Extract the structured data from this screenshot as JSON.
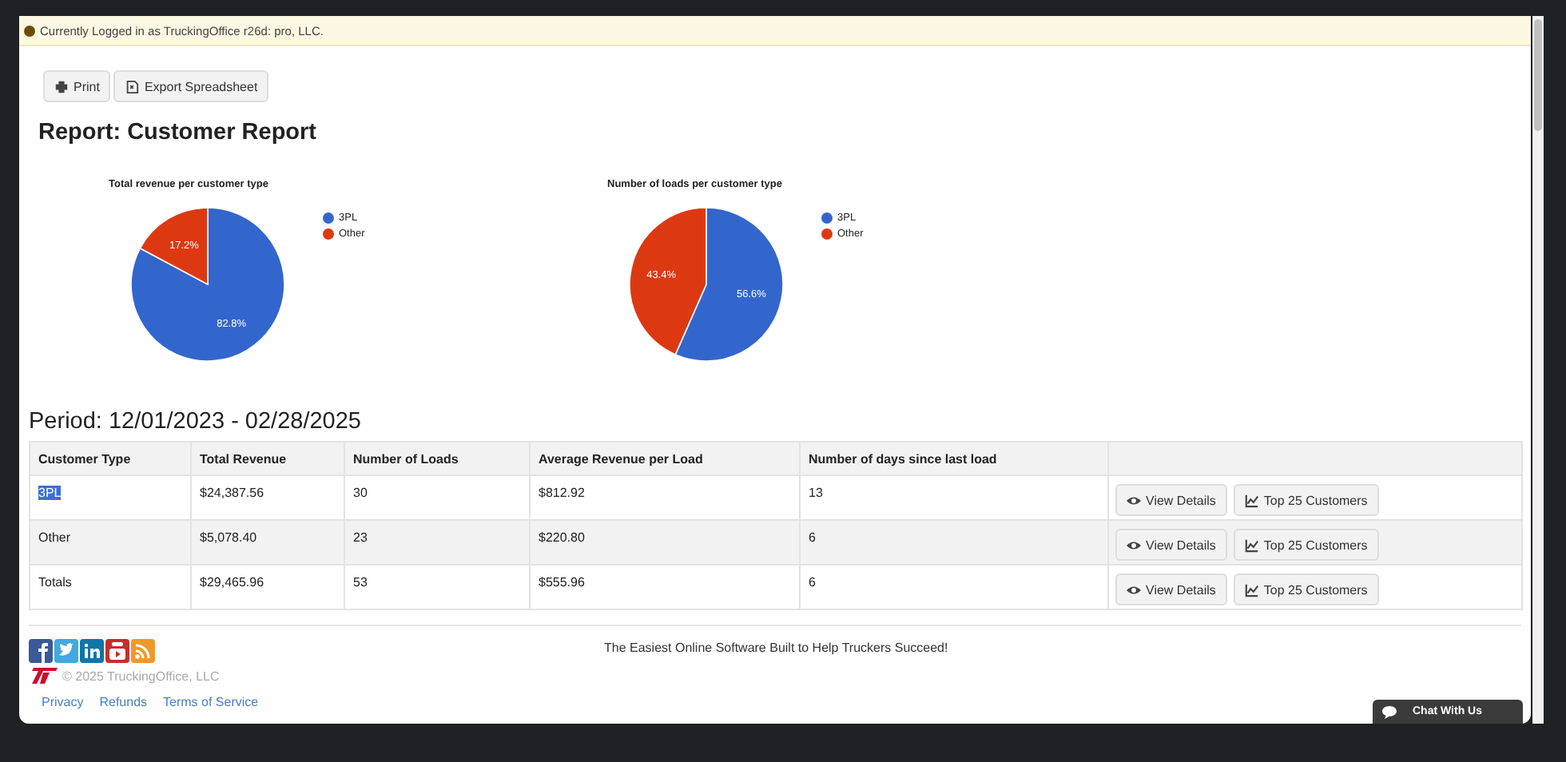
{
  "notice": {
    "text": "Currently Logged in as TruckingOffice r26d: pro, LLC."
  },
  "toolbar": [
    {
      "label": "Print",
      "kind": "print"
    },
    {
      "label": "Export Spreadsheet",
      "kind": "export"
    }
  ],
  "title": "Report: Customer Report",
  "charts": [
    {
      "chart_data": {
        "type": "pie",
        "title": "Total revenue per customer type",
        "categories": [
          "3PL",
          "Other"
        ],
        "values": [
          82.8,
          17.2
        ],
        "colors": [
          "#3366cc",
          "#dc3912"
        ],
        "legend": true,
        "value_labels": [
          "82.8%",
          "17.2%"
        ]
      }
    },
    {
      "chart_data": {
        "type": "pie",
        "title": "Number of loads per customer type",
        "categories": [
          "3PL",
          "Other"
        ],
        "values": [
          56.6,
          43.4
        ],
        "colors": [
          "#3366cc",
          "#dc3912"
        ],
        "legend": true,
        "value_labels": [
          "56.6%",
          "43.4%"
        ]
      }
    }
  ],
  "period": "Period: 12/01/2023 - 02/28/2025",
  "table": {
    "columns": [
      "Customer Type",
      "Total Revenue",
      "Number of Loads",
      "Average Revenue per Load",
      "Number of days since last load"
    ],
    "rows": [
      {
        "cells": [
          "3PL",
          "$24,387.56",
          "30",
          "$812.92",
          "13"
        ],
        "highlighted": true,
        "actions": [
          {
            "label": "View Details",
            "kind": "view"
          },
          {
            "label": "Top 25 Customers",
            "kind": "chart"
          }
        ]
      },
      {
        "cells": [
          "Other",
          "$5,078.40",
          "23",
          "$220.80",
          "6"
        ],
        "highlighted": false,
        "actions": [
          {
            "label": "View Details",
            "kind": "view"
          },
          {
            "label": "Top 25 Customers",
            "kind": "chart"
          }
        ]
      },
      {
        "cells": [
          "Totals",
          "$29,465.96",
          "53",
          "$555.96",
          "6"
        ],
        "highlighted": false,
        "actions": [
          {
            "label": "View Details",
            "kind": "view"
          },
          {
            "label": "Top 25 Customers",
            "kind": "chart"
          }
        ]
      }
    ]
  },
  "footer": {
    "tagline": "The Easiest Online Software Built to Help Truckers Succeed!",
    "copyright": "© 2025 TruckingOffice, LLC",
    "links": [
      "Privacy",
      "Refunds",
      "Terms of Service"
    ]
  },
  "chat": {
    "label": "Chat With Us"
  }
}
